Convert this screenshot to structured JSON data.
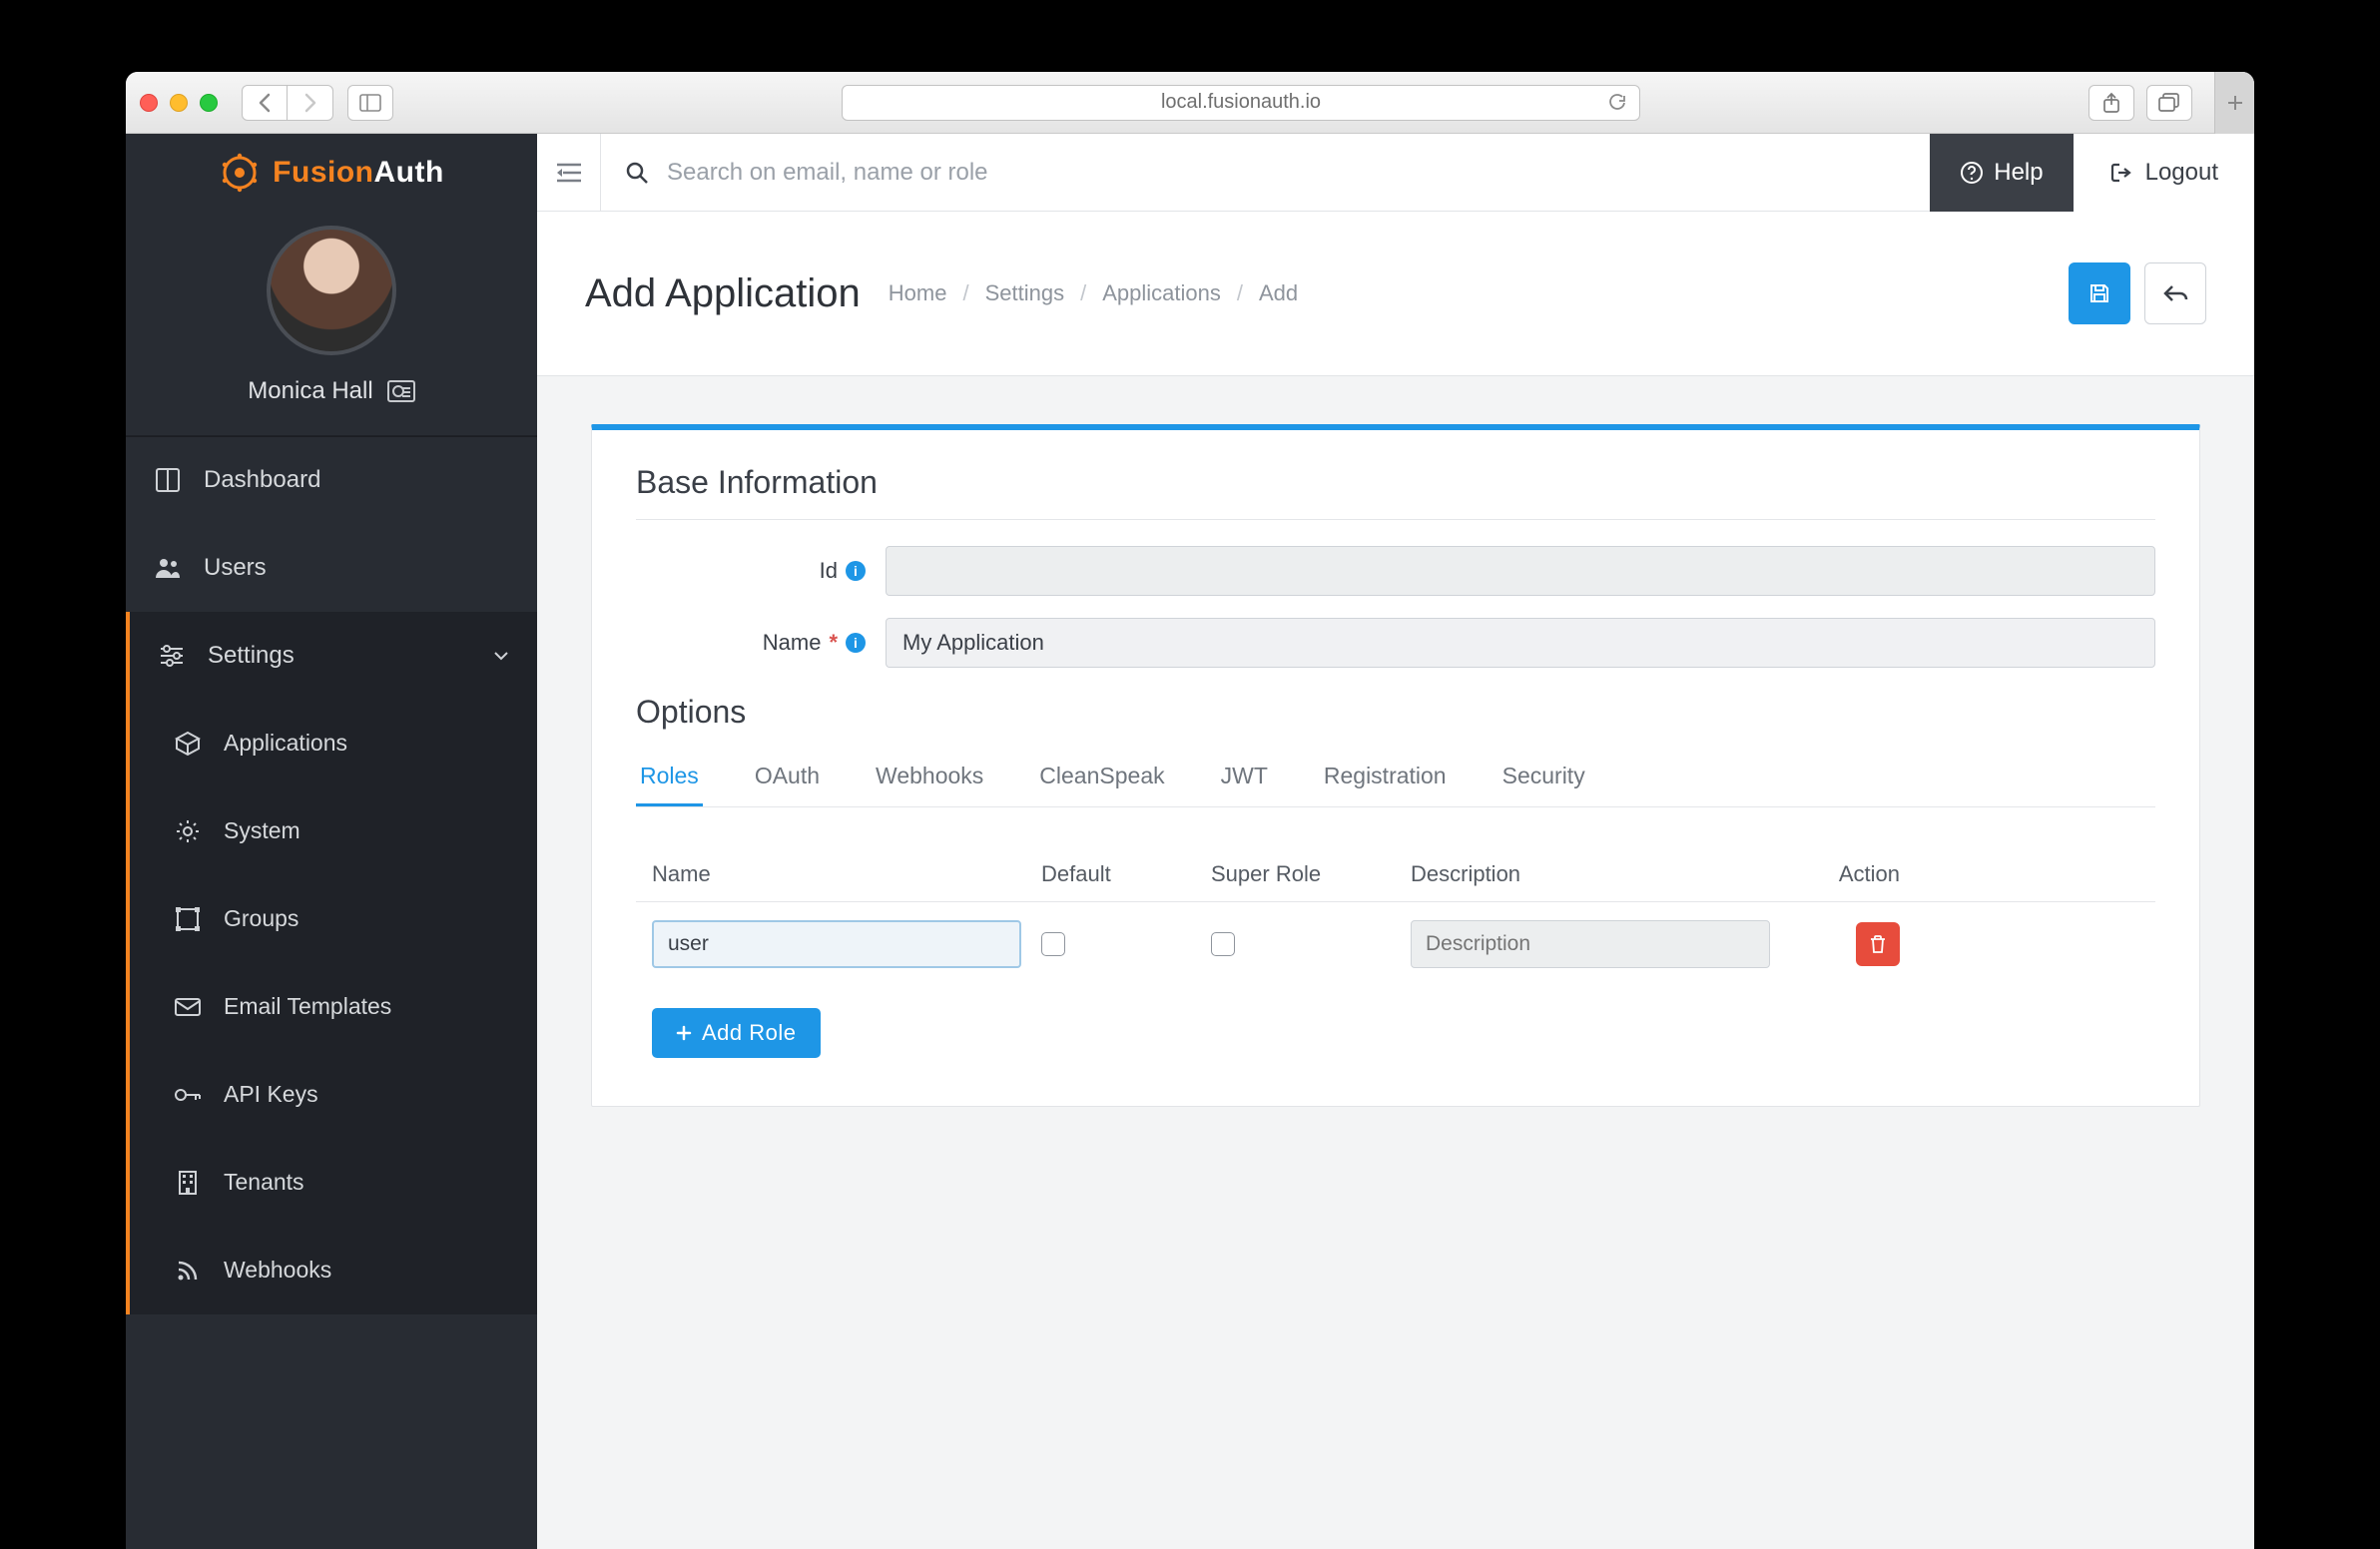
{
  "browser": {
    "url": "local.fusionauth.io"
  },
  "brand": {
    "name_prefix": "Fusion",
    "name_suffix": "Auth"
  },
  "user": {
    "name": "Monica Hall"
  },
  "sidebar": {
    "items": [
      {
        "label": "Dashboard"
      },
      {
        "label": "Users"
      },
      {
        "label": "Settings"
      }
    ],
    "settings_children": [
      {
        "label": "Applications"
      },
      {
        "label": "System"
      },
      {
        "label": "Groups"
      },
      {
        "label": "Email Templates"
      },
      {
        "label": "API Keys"
      },
      {
        "label": "Tenants"
      },
      {
        "label": "Webhooks"
      }
    ]
  },
  "topbar": {
    "search_placeholder": "Search on email, name or role",
    "help_label": "Help",
    "logout_label": "Logout"
  },
  "page": {
    "title": "Add Application",
    "breadcrumb": [
      "Home",
      "Settings",
      "Applications",
      "Add"
    ]
  },
  "form": {
    "section1_title": "Base Information",
    "id_label": "Id",
    "id_value": "",
    "name_label": "Name",
    "name_value": "My Application",
    "section2_title": "Options"
  },
  "tabs": [
    "Roles",
    "OAuth",
    "Webhooks",
    "CleanSpeak",
    "JWT",
    "Registration",
    "Security"
  ],
  "active_tab": "Roles",
  "roles": {
    "headers": {
      "name": "Name",
      "default": "Default",
      "super": "Super Role",
      "desc": "Description",
      "action": "Action"
    },
    "rows": [
      {
        "name": "user",
        "default": false,
        "super": false,
        "desc": ""
      }
    ],
    "desc_placeholder": "Description",
    "add_label": "Add Role"
  }
}
